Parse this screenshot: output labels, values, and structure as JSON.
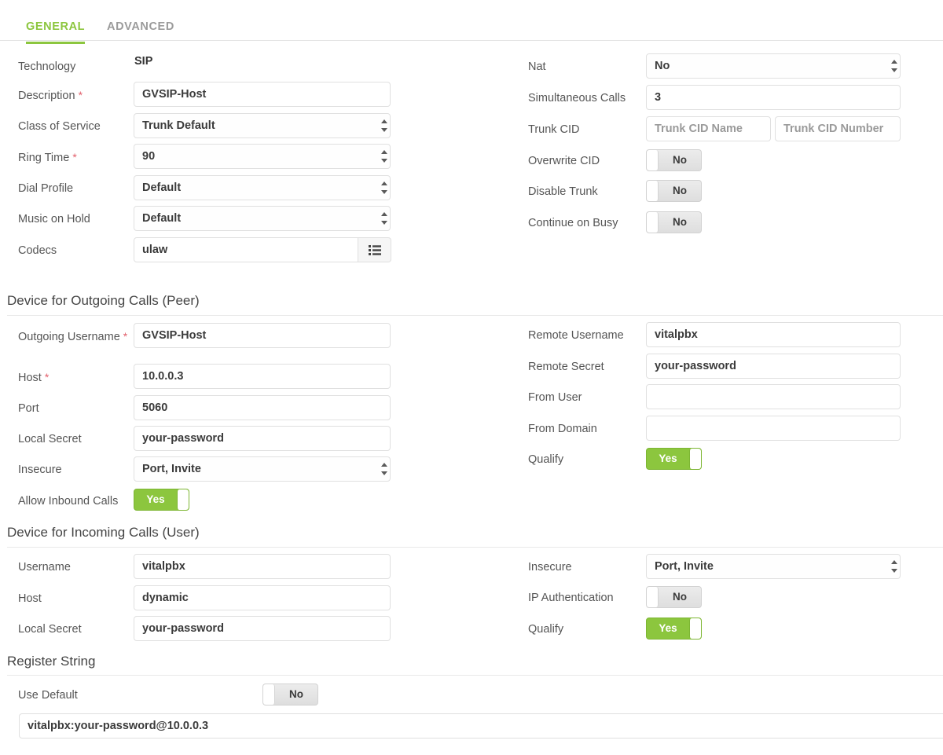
{
  "tabs": [
    {
      "id": "general",
      "label": "GENERAL",
      "active": true
    },
    {
      "id": "advanced",
      "label": "ADVANCED",
      "active": false
    }
  ],
  "colors": {
    "accent": "#8cc63e",
    "required": "#e2606c",
    "border": "#e0e0e0"
  },
  "general": {
    "left": {
      "technology": {
        "label": "Technology",
        "value": "SIP"
      },
      "description": {
        "label": "Description",
        "required": "*",
        "value": "GVSIP-Host"
      },
      "class_of_service": {
        "label": "Class of Service",
        "value": "Trunk Default"
      },
      "ring_time": {
        "label": "Ring Time",
        "required": "*",
        "value": "90"
      },
      "dial_profile": {
        "label": "Dial Profile",
        "value": "Default"
      },
      "music_on_hold": {
        "label": "Music on Hold",
        "value": "Default"
      },
      "codecs": {
        "label": "Codecs",
        "value": "ulaw",
        "button_icon": "list-icon"
      }
    },
    "right": {
      "nat": {
        "label": "Nat",
        "value": "No"
      },
      "simultaneous_calls": {
        "label": "Simultaneous Calls",
        "value": "3"
      },
      "trunk_cid": {
        "label": "Trunk CID",
        "name_placeholder": "Trunk CID Name",
        "number_placeholder": "Trunk CID Number"
      },
      "overwrite_cid": {
        "label": "Overwrite CID",
        "value": "No",
        "on": false
      },
      "disable_trunk": {
        "label": "Disable Trunk",
        "value": "No",
        "on": false
      },
      "continue_on_busy": {
        "label": "Continue on Busy",
        "value": "No",
        "on": false
      }
    }
  },
  "outgoing": {
    "title": "Device for Outgoing Calls (Peer)",
    "left": {
      "outgoing_username": {
        "label": "Outgoing Username",
        "required": "*",
        "value": "GVSIP-Host"
      },
      "host": {
        "label": "Host",
        "required": "*",
        "value": "10.0.0.3"
      },
      "port": {
        "label": "Port",
        "value": "5060"
      },
      "local_secret": {
        "label": "Local Secret",
        "value": "your-password"
      },
      "insecure": {
        "label": "Insecure",
        "value": "Port, Invite"
      },
      "allow_inbound_calls": {
        "label": "Allow Inbound Calls",
        "value": "Yes",
        "on": true
      }
    },
    "right": {
      "remote_username": {
        "label": "Remote Username",
        "value": "vitalpbx"
      },
      "remote_secret": {
        "label": "Remote Secret",
        "value": "your-password"
      },
      "from_user": {
        "label": "From User",
        "value": ""
      },
      "from_domain": {
        "label": "From Domain",
        "value": ""
      },
      "qualify": {
        "label": "Qualify",
        "value": "Yes",
        "on": true
      }
    }
  },
  "incoming": {
    "title": "Device for Incoming Calls (User)",
    "left": {
      "username": {
        "label": "Username",
        "value": "vitalpbx"
      },
      "host": {
        "label": "Host",
        "value": "dynamic"
      },
      "local_secret": {
        "label": "Local Secret",
        "value": "your-password"
      }
    },
    "right": {
      "insecure": {
        "label": "Insecure",
        "value": "Port, Invite"
      },
      "ip_authentication": {
        "label": "IP Authentication",
        "value": "No",
        "on": false
      },
      "qualify": {
        "label": "Qualify",
        "value": "Yes",
        "on": true
      }
    }
  },
  "register_string": {
    "title": "Register String",
    "use_default": {
      "label": "Use Default",
      "value": "No",
      "on": false
    },
    "value": "vitalpbx:your-password@10.0.0.3"
  }
}
